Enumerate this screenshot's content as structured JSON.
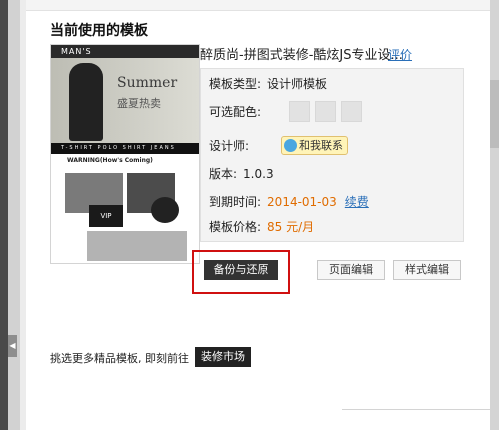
{
  "section": {
    "title": "当前使用的模板"
  },
  "preview": {
    "logo": "MAN'S",
    "hero_en": "Summer",
    "hero_cn": "盛夏热卖",
    "menu": "T-SHIRT POLO SHIRT JEANS PANTS SHORT ALL",
    "warning": "WARNING(How's Coming)",
    "vip": "VIP"
  },
  "template": {
    "title": "醉质尚-拼图式装修-酷炫JS专业设...",
    "review_link": "评价",
    "type_label": "模板类型:",
    "type_value": "设计师模板",
    "colors_label": "可选配色:",
    "designer_label": "设计师:",
    "contact_label": "和我联系",
    "version_label": "版本:",
    "version_value": "1.0.3",
    "expiry_label": "到期时间:",
    "expiry_value": "2014-01-03",
    "renew_link": "续费",
    "price_label": "模板价格:",
    "price_value": "85 元/月"
  },
  "actions": {
    "backup_label": "备份与还原",
    "page_edit_label": "页面编辑",
    "style_edit_label": "样式编辑"
  },
  "footer": {
    "text": "挑选更多精品模板,  即刻前往",
    "market_button": "装修市场"
  },
  "colors": {
    "highlight_border": "#d01010",
    "price": "#e06c00",
    "link": "#2a6fb8",
    "dark_button": "#333333"
  }
}
